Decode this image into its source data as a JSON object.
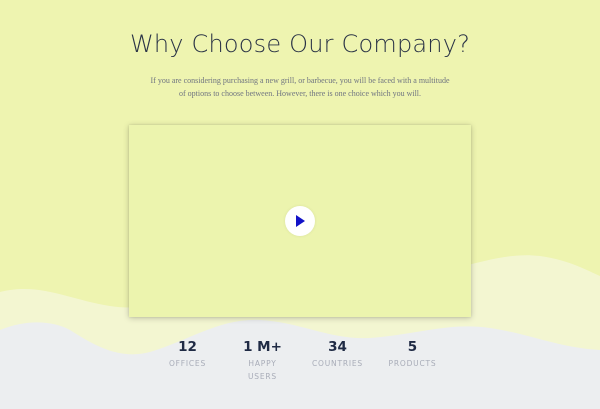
{
  "section": {
    "title": "Why Choose Our Company?",
    "description": "If you are considering purchasing a new grill, or barbecue, you will be faced with a multitude of options to choose between. However, there is one choice which you will."
  },
  "video": {
    "play_icon": "play-triangle"
  },
  "stats": [
    {
      "value": "12",
      "label": "OFFICES"
    },
    {
      "value": "1 M+",
      "label": "HAPPY USERS"
    },
    {
      "value": "34",
      "label": "COUNTRIES"
    },
    {
      "value": "5",
      "label": "PRODUCTS"
    }
  ],
  "colors": {
    "background": "#eef4b0",
    "wave": "#eceef0",
    "heading": "#2a3346",
    "play_icon": "#1212c8"
  }
}
